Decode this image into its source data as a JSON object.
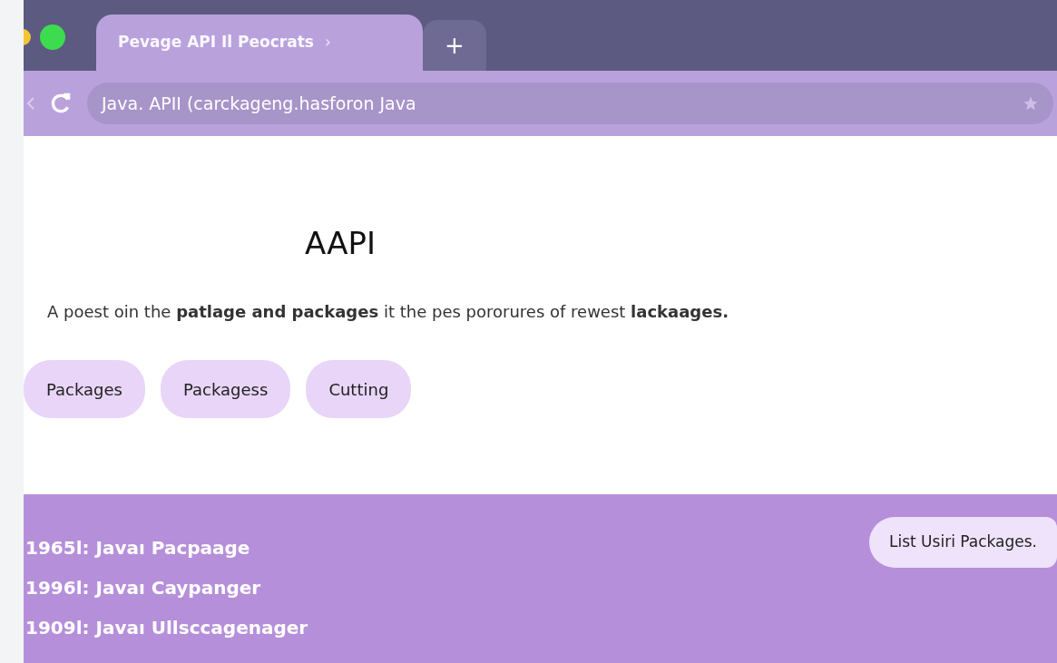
{
  "browser": {
    "tab": {
      "title": "Pevage API Il Peocrats",
      "chevron": "›",
      "selected": true
    },
    "new_tab": "+",
    "address": "Java. APII (carckageng.hasforon Java"
  },
  "page": {
    "title": "AAPI",
    "description": "A poest oin the **patlage and packages** it the pes pororures of rewest **lackaages.**",
    "chips": [
      {
        "label": "Packages"
      },
      {
        "label": "Packagess"
      },
      {
        "label": "Cutting"
      }
    ]
  },
  "footer": {
    "items": [
      "1965l: Javaı Pacpaage",
      "1996l: Javaı Caypanger",
      "1909l: Javaı Ullsccagenager"
    ],
    "button": "List Usiri Packages."
  }
}
